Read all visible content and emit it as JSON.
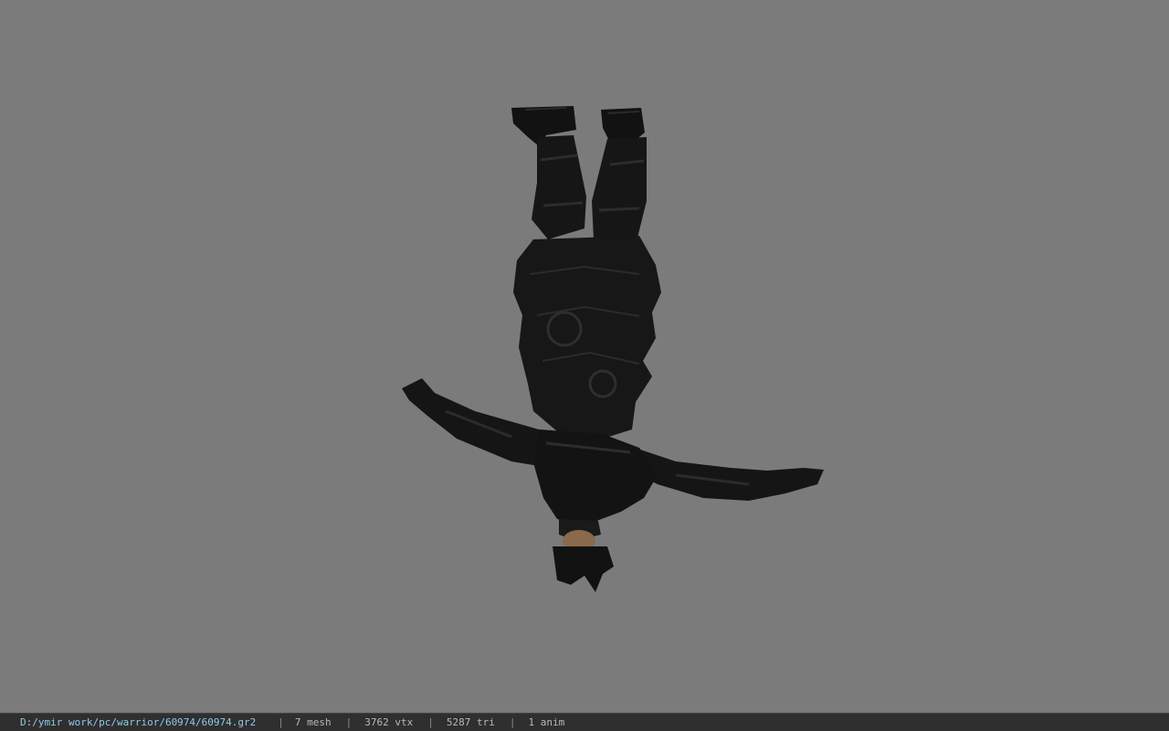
{
  "status_bar": {
    "file_path": "D:/ymir work/pc/warrior/60974/60974.gr2",
    "mesh_count": "7 mesh",
    "vertex_count": "3762 vtx",
    "triangle_count": "5287 tri",
    "anim_count": "1 anim",
    "separator": "|"
  },
  "viewport": {
    "background_color": "#7b7b7b",
    "model_color": "#141414",
    "skin_color": "#8a6a4c"
  }
}
